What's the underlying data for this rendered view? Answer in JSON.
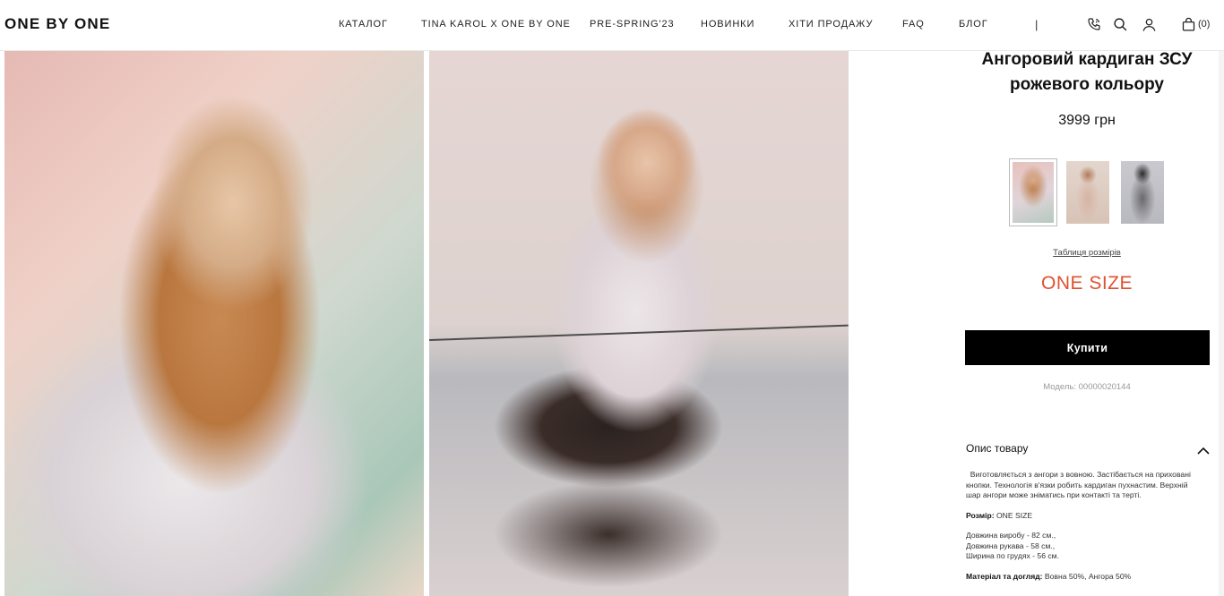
{
  "brand": "ONE BY ONE",
  "nav": [
    {
      "label": "КАТАЛОГ"
    },
    {
      "label": "TINA KAROL X ONE BY ONE"
    },
    {
      "label": "PRE-SPRING'23"
    },
    {
      "label": "НОВИНКИ"
    },
    {
      "label": "ХІТИ ПРОДАЖУ"
    },
    {
      "label": "FAQ"
    },
    {
      "label": "БЛОГ"
    }
  ],
  "nav_separator": "|",
  "header_icons": [
    "phone-icon",
    "search-icon",
    "user-icon",
    "shopping-bag-icon"
  ],
  "cart_count": "(0)",
  "product": {
    "title_line1": "Ангоровий кардиган ЗСУ",
    "title_line2": "рожевого кольору",
    "price": "3999 грн",
    "size_table_link": "Таблиця розмірів",
    "size": "ONE SIZE",
    "buy_label": "Купити",
    "model": "Модель: 00000020144"
  },
  "description": {
    "heading": "Опис товару",
    "text": "Виготовляється з ангори з вовною. Застібається на приховані кнопки. Технологія в'язки робить кардиган пухнастим. Верхній шар ангори може зніматись при контакті та терті.",
    "size_label": "Розмір:",
    "size_value": " ONE SIZE",
    "length": "Довжина виробу - 82 см.,",
    "sleeve": "Довжина рукава - 58 см.,",
    "chest": "Ширина по грудях - 56 см.",
    "material_label": "Матеріал та догляд:",
    "material_value": " Вовна 50%, Ангора 50%"
  },
  "colors": {
    "accent_size": "#e0512f",
    "button_bg": "#000000",
    "button_text": "#ffffff"
  }
}
